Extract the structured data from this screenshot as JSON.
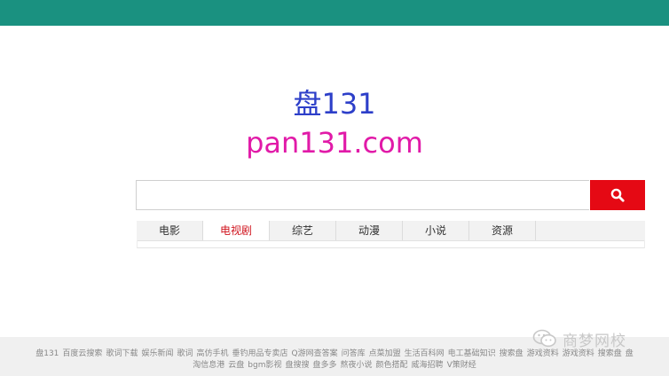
{
  "header": {
    "color": "#1a9180"
  },
  "logo": {
    "title_cn": "盘131",
    "title_en": "pan131.com"
  },
  "search": {
    "placeholder": "",
    "value": ""
  },
  "tabs": [
    {
      "label": "电影",
      "active": false
    },
    {
      "label": "电视剧",
      "active": true
    },
    {
      "label": "综艺",
      "active": false
    },
    {
      "label": "动漫",
      "active": false
    },
    {
      "label": "小说",
      "active": false
    },
    {
      "label": "资源",
      "active": false
    }
  ],
  "footer": {
    "line1": [
      "盘131",
      "百度云搜索",
      "歌词下载",
      "娱乐新闻",
      "歌词",
      "高仿手机",
      "垂钓用品专卖店",
      "Q游网查答案",
      "问答库",
      "点菜加盟",
      "生活百科网",
      "电工基础知识",
      "搜索盘",
      "游戏资料",
      "游戏资料",
      "搜索盘",
      "盘"
    ],
    "line2": [
      "淘信息港",
      "云盘",
      "bgm影视",
      "盘搜搜",
      "盘多多",
      "熬夜小说",
      "颜色搭配",
      "威海招聘",
      "V策财经"
    ]
  },
  "watermark": {
    "text": "商梦网校",
    "icon": "wechat-icon"
  },
  "colors": {
    "accent_red": "#e50914",
    "logo_blue": "#2d3fc9",
    "logo_pink": "#e11aa8"
  }
}
